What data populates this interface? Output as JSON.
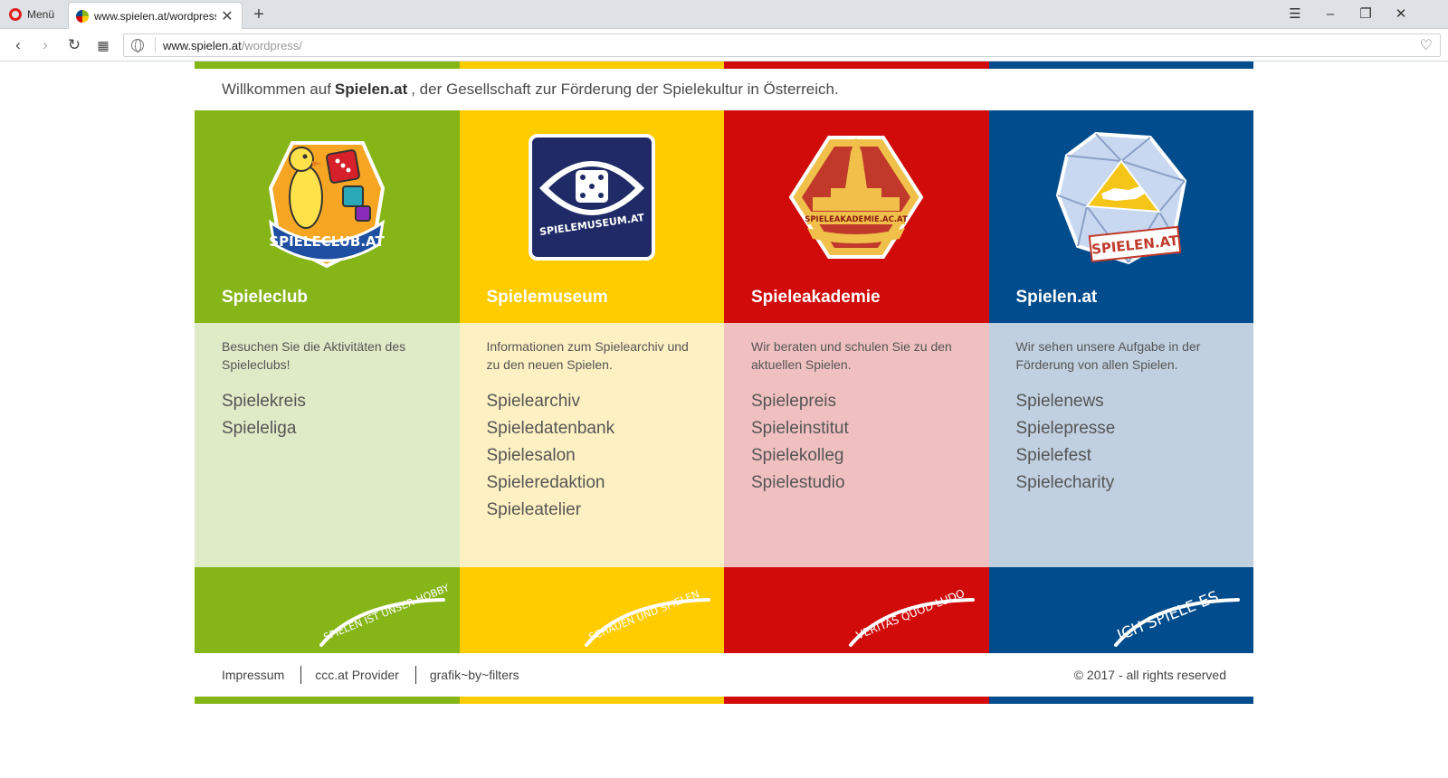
{
  "browser": {
    "menu_label": "Menü",
    "tab_title": "www.spielen.at/wordpress",
    "url_host": "www.spielen.at",
    "url_path": "/wordpress/"
  },
  "colors": {
    "green": "#86b518",
    "yellow": "#ffcc00",
    "red": "#d10a0a",
    "blue": "#004c8c",
    "green_light": "#dfeac6",
    "yellow_light": "#fdf0c2",
    "red_light": "#f0c0c0",
    "blue_light": "#c0d0e0"
  },
  "welcome": {
    "before": "Willkommen auf",
    "brand": "Spielen.at",
    "after": ", der Gesellschaft zur Förderung der Spielekultur in Österreich."
  },
  "columns": [
    {
      "title": "Spieleclub",
      "logo_text": "SPIELECLUB.AT",
      "logo_icon": "penguin-dice-logo",
      "description": "Besuchen Sie die Aktivitäten des Spieleclubs!",
      "links": [
        "Spielekreis",
        "Spieleliga"
      ],
      "slogan": "SPIELEN IST UNSER HOBBY"
    },
    {
      "title": "Spielemuseum",
      "logo_text": "SPIELEMUSEUM.AT",
      "logo_icon": "eye-dice-logo",
      "description": "Informationen zum Spielearchiv und zu den neuen Spielen.",
      "links": [
        "Spielearchiv",
        "Spieledatenbank",
        "Spielesalon",
        "Spieleredaktion",
        "Spieleatelier"
      ],
      "slogan": "SCHAUEN UND SPIELEN"
    },
    {
      "title": "Spieleakademie",
      "logo_text": "SPIELEAKADEMIE.AC.AT",
      "logo_icon": "cathedral-logo",
      "description": "Wir beraten und schulen Sie zu den aktuellen Spielen.",
      "links": [
        "Spielepreis",
        "Spieleinstitut",
        "Spielekolleg",
        "Spielestudio"
      ],
      "slogan": "VERITAS QUOD LUDO"
    },
    {
      "title": "Spielen.at",
      "logo_text": "SPIELEN.AT",
      "logo_icon": "icosahedron-austria-logo",
      "description": "Wir sehen unsere Aufgabe in der Förderung von allen Spielen.",
      "links": [
        "Spielenews",
        "Spielepresse",
        "Spielefest",
        "Spielecharity"
      ],
      "slogan": "ICH SPIELE ES"
    }
  ],
  "footer": {
    "links": [
      "Impressum",
      "ccc.at Provider",
      "grafik~by~filters"
    ],
    "copyright": "© 2017 - all rights reserved"
  }
}
